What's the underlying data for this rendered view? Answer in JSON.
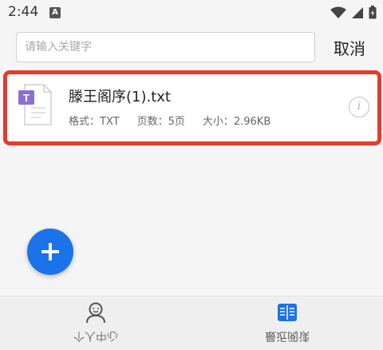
{
  "status_bar": {
    "time": "2:44",
    "notification_badge": "A",
    "icons": [
      "wifi-icon",
      "signal-icon",
      "battery-icon"
    ]
  },
  "search": {
    "placeholder": "请输入关键字",
    "value": "",
    "cancel_label": "取消"
  },
  "file": {
    "icon": "txt-file-icon",
    "icon_letter": "T",
    "name": "滕王阁序(1).txt",
    "format_label": "格式：TXT",
    "pages_label": "页数：5页",
    "size_label": "大小：2.96KB",
    "info_icon": "i"
  },
  "fab": {
    "icon": "plus-icon"
  },
  "bottom_nav": {
    "tabs": [
      {
        "label": "个人中心",
        "icon": "person-icon"
      },
      {
        "label": "最近阅读",
        "icon": "book-icon"
      }
    ]
  },
  "colors": {
    "accent": "#1a73e8",
    "highlight_border": "#e53b2c",
    "file_icon_purple": "#8e6fd0"
  }
}
